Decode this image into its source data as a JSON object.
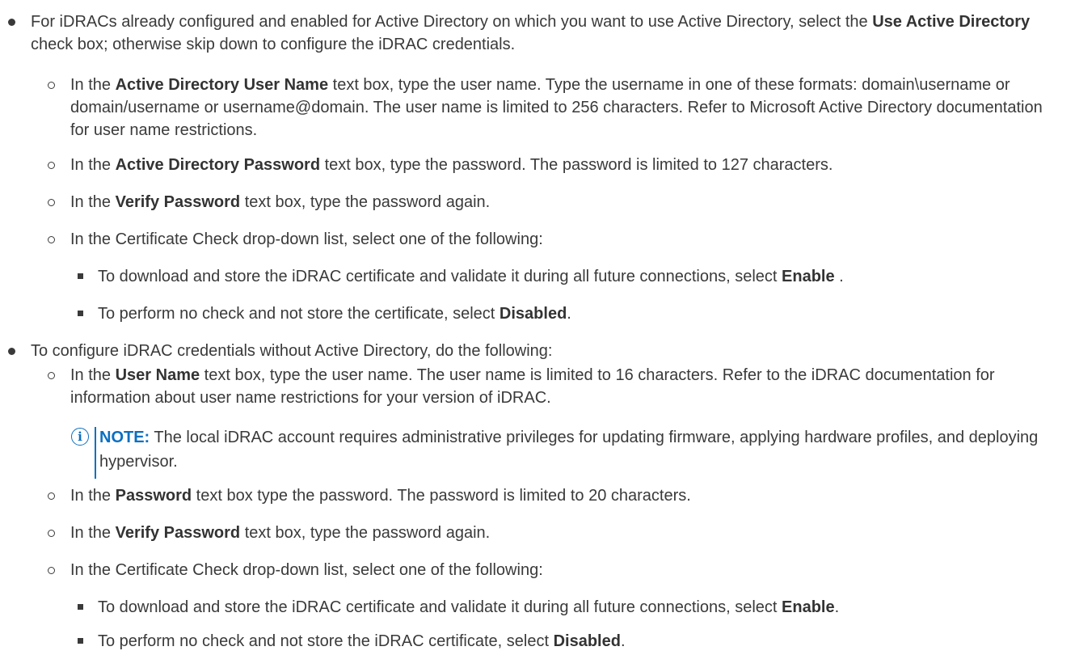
{
  "items": [
    {
      "parts": [
        "For iDRACs already configured and enabled for Active Directory on which you want to use Active Directory, select the ",
        "Use Active Directory",
        " check box; otherwise skip down to configure the iDRAC credentials."
      ]
    },
    {
      "parts": [
        "In the ",
        "Active Directory User Name",
        " text box, type the user name. Type the username in one of these formats: domain\\username or domain/username or username@domain. The user name is limited to 256 characters. Refer to Microsoft Active Directory documentation for user name restrictions."
      ]
    },
    {
      "parts": [
        "In the ",
        "Active Directory Password",
        " text box, type the password. The password is limited to 127 characters."
      ]
    },
    {
      "parts": [
        "In the ",
        "Verify Password",
        " text box, type the password again."
      ]
    },
    {
      "parts": [
        "In the Certificate Check drop-down list, select one of the following:"
      ]
    },
    {
      "parts": [
        "To download and store the iDRAC certificate and validate it during all future connections, select ",
        "Enable",
        " ."
      ]
    },
    {
      "parts": [
        "To perform no check and not store the certificate, select ",
        "Disabled",
        "."
      ]
    },
    {
      "parts": [
        "To configure iDRAC credentials without Active Directory, do the following:"
      ]
    },
    {
      "parts": [
        "In the ",
        "User Name",
        " text box, type the user name. The user name is limited to 16 characters. Refer to the iDRAC documentation for information about user name restrictions for your version of iDRAC."
      ]
    },
    {
      "parts": [
        "In the ",
        "Password",
        " text box type the password. The password is limited to 20 characters."
      ]
    },
    {
      "parts": [
        "In the ",
        "Verify Password",
        " text box, type the password again."
      ]
    },
    {
      "parts": [
        "In the Certificate Check drop-down list, select one of the following:"
      ]
    },
    {
      "parts": [
        "To download and store the iDRAC certificate and validate it during all future connections, select ",
        "Enable",
        "."
      ]
    },
    {
      "parts": [
        "To perform no check and not store the iDRAC certificate, select ",
        "Disabled",
        "."
      ]
    }
  ],
  "note": {
    "icon": "i",
    "label": "NOTE:",
    "text": " The local iDRAC account requires administrative privileges for updating firmware, applying hardware profiles, and deploying hypervisor."
  }
}
